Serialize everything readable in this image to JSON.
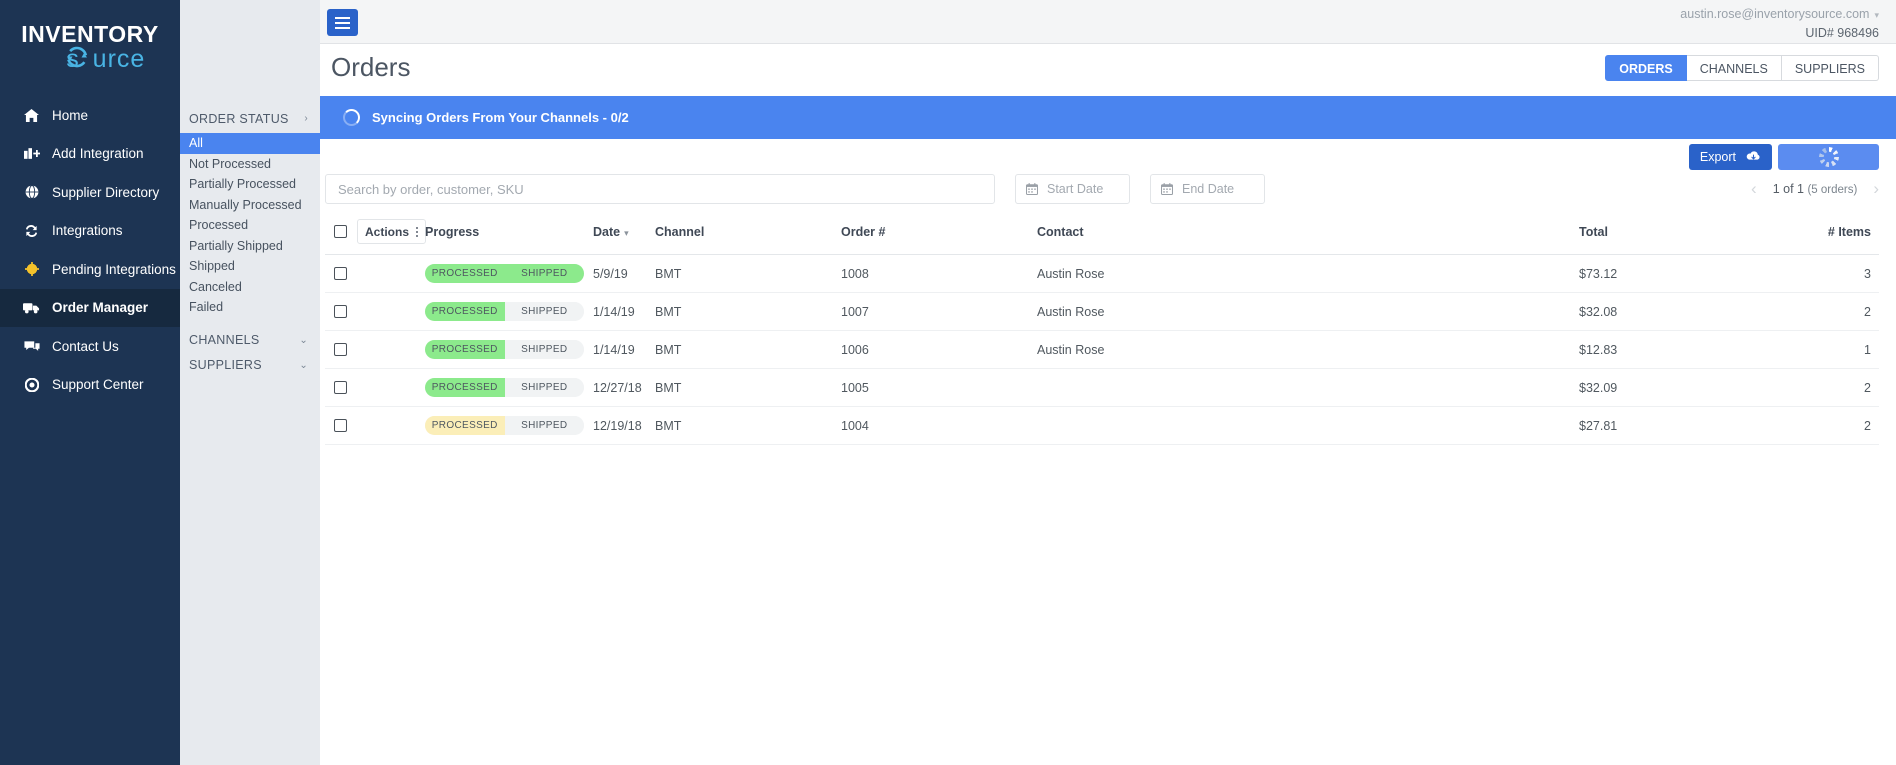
{
  "brand": {
    "logo_line1": "INVENTORY",
    "logo_line2": "source",
    "accent_blue": "#4a84ef",
    "sidebar_bg": "#1d3453",
    "badge_green": "#8cea8c",
    "badge_yellow": "#fbeeb8",
    "badge_grey": "#f1f3f4"
  },
  "topbar": {
    "user_email": "austin.rose@inventorysource.com",
    "uid_label": "UID# 968496",
    "caret": "▾"
  },
  "sidebar": {
    "items": [
      {
        "label": "Home",
        "icon": "home-icon",
        "active": false
      },
      {
        "label": "Add Integration",
        "icon": "add-integration-icon",
        "active": false
      },
      {
        "label": "Supplier Directory",
        "icon": "globe-icon",
        "active": false
      },
      {
        "label": "Integrations",
        "icon": "sync-icon",
        "active": false
      },
      {
        "label": "Pending Integrations",
        "icon": "pending-dot-icon",
        "active": false
      },
      {
        "label": "Order Manager",
        "icon": "truck-icon",
        "active": true
      },
      {
        "label": "Contact Us",
        "icon": "chat-icon",
        "active": false
      },
      {
        "label": "Support Center",
        "icon": "lifebuoy-icon",
        "active": false
      }
    ]
  },
  "page": {
    "title": "Orders",
    "tabs": [
      {
        "label": "ORDERS",
        "active": true
      },
      {
        "label": "CHANNELS",
        "active": false
      },
      {
        "label": "SUPPLIERS",
        "active": false
      }
    ]
  },
  "sync_banner": {
    "text": "Syncing Orders From Your Channels - 0/2"
  },
  "filters": {
    "order_status": {
      "heading": "ORDER STATUS",
      "chevron": "›",
      "items": [
        {
          "label": "All",
          "selected": true
        },
        {
          "label": "Not Processed",
          "selected": false
        },
        {
          "label": "Partially Processed",
          "selected": false
        },
        {
          "label": "Manually Processed",
          "selected": false
        },
        {
          "label": "Processed",
          "selected": false
        },
        {
          "label": "Partially Shipped",
          "selected": false
        },
        {
          "label": "Shipped",
          "selected": false
        },
        {
          "label": "Canceled",
          "selected": false
        },
        {
          "label": "Failed",
          "selected": false
        }
      ]
    },
    "channels": {
      "heading": "CHANNELS",
      "chevron": "⌄"
    },
    "suppliers": {
      "heading": "SUPPLIERS",
      "chevron": "⌄"
    }
  },
  "toolbar": {
    "export_label": "Export",
    "export_icon": "download-cloud-icon",
    "loading_icon": "spinner-icon"
  },
  "search": {
    "placeholder": "Search by order, customer, SKU",
    "value": "",
    "start_date_placeholder": "Start Date",
    "end_date_placeholder": "End Date"
  },
  "pagination": {
    "prev": "‹",
    "next": "›",
    "range": "1 of 1",
    "count": "(5 orders)"
  },
  "table": {
    "headers": {
      "actions": "Actions",
      "progress": "Progress",
      "date": "Date",
      "channel": "Channel",
      "order": "Order #",
      "contact": "Contact",
      "total": "Total",
      "items": "# Items"
    },
    "rows": [
      {
        "progress": {
          "left": "PROCESSED",
          "left_state": "green",
          "right": "SHIPPED",
          "right_state": "green"
        },
        "date": "5/9/19",
        "channel": "BMT",
        "order": "1008",
        "contact": "Austin Rose",
        "total": "$73.12",
        "items": "3"
      },
      {
        "progress": {
          "left": "PROCESSED",
          "left_state": "green",
          "right": "SHIPPED",
          "right_state": "grey"
        },
        "date": "1/14/19",
        "channel": "BMT",
        "order": "1007",
        "contact": "Austin Rose",
        "total": "$32.08",
        "items": "2"
      },
      {
        "progress": {
          "left": "PROCESSED",
          "left_state": "green",
          "right": "SHIPPED",
          "right_state": "grey"
        },
        "date": "1/14/19",
        "channel": "BMT",
        "order": "1006",
        "contact": "Austin Rose",
        "total": "$12.83",
        "items": "1"
      },
      {
        "progress": {
          "left": "PROCESSED",
          "left_state": "green",
          "right": "SHIPPED",
          "right_state": "grey"
        },
        "date": "12/27/18",
        "channel": "BMT",
        "order": "1005",
        "contact": "",
        "total": "$32.09",
        "items": "2"
      },
      {
        "progress": {
          "left": "PROCESSED",
          "left_state": "yellow",
          "right": "SHIPPED",
          "right_state": "grey"
        },
        "date": "12/19/18",
        "channel": "BMT",
        "order": "1004",
        "contact": "",
        "total": "$27.81",
        "items": "2"
      }
    ]
  }
}
